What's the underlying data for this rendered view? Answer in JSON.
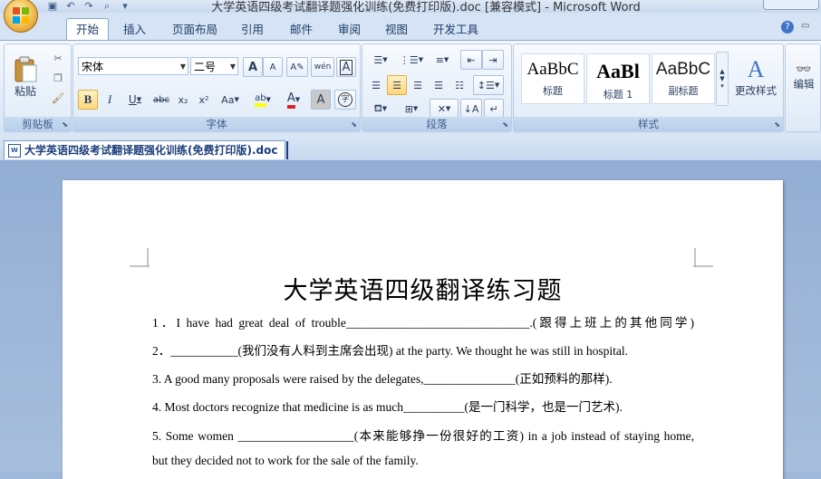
{
  "window": {
    "title": "大学英语四级考试翻译题强化训练(免费打印版).doc [兼容模式] - Microsoft Word"
  },
  "tabs": [
    {
      "label": "开始",
      "active": true
    },
    {
      "label": "插入"
    },
    {
      "label": "页面布局"
    },
    {
      "label": "引用"
    },
    {
      "label": "邮件"
    },
    {
      "label": "审阅"
    },
    {
      "label": "视图"
    },
    {
      "label": "开发工具"
    }
  ],
  "ribbon": {
    "clipboard": {
      "label": "剪贴板",
      "paste_label": "粘贴"
    },
    "font": {
      "label": "字体",
      "font_name": "宋体",
      "font_size": "二号",
      "bold": "B",
      "italic": "I",
      "underline": "U",
      "strike": "abc",
      "subscript": "x₂",
      "superscript": "x²",
      "change_case": "Aa",
      "grow": "A",
      "shrink": "A",
      "wen": "wén",
      "font_color": "A",
      "char_shading": "A",
      "enclose": "字"
    },
    "paragraph": {
      "label": "段落"
    },
    "styles": {
      "label": "样式",
      "items": [
        {
          "sample": "AaBbC",
          "name": "标题"
        },
        {
          "sample": "AaBl",
          "name": "标题 1"
        },
        {
          "sample": "AaBbC",
          "name": "副标题"
        }
      ],
      "change_styles": "更改样式"
    },
    "editing": {
      "label": "编辑"
    }
  },
  "document_tab": {
    "label": "大学英语四级考试翻译题强化训练(免费打印版).doc"
  },
  "document": {
    "title": "大学英语四级翻译练习题",
    "lines": [
      "1．I have had great deal of trouble______________________________.(跟得上班上的其他同学)",
      "2．___________(我们没有人料到主席会出现) at the party. We thought he was still in hospital.",
      "3. A good many proposals were raised by the delegates,_______________(正如预料的那样).",
      "4. Most doctors recognize that medicine is as much__________(是一门科学，也是一门艺术).",
      "5. Some women ___________________(本来能够挣一份很好的工资) in a job instead of staying home,",
      "but they decided not to work for the sale of the family."
    ]
  },
  "colors": {
    "ribbon_bg": "#dfeaf7",
    "accent": "#2b579a",
    "doc_bg": "#9fb7d8"
  }
}
